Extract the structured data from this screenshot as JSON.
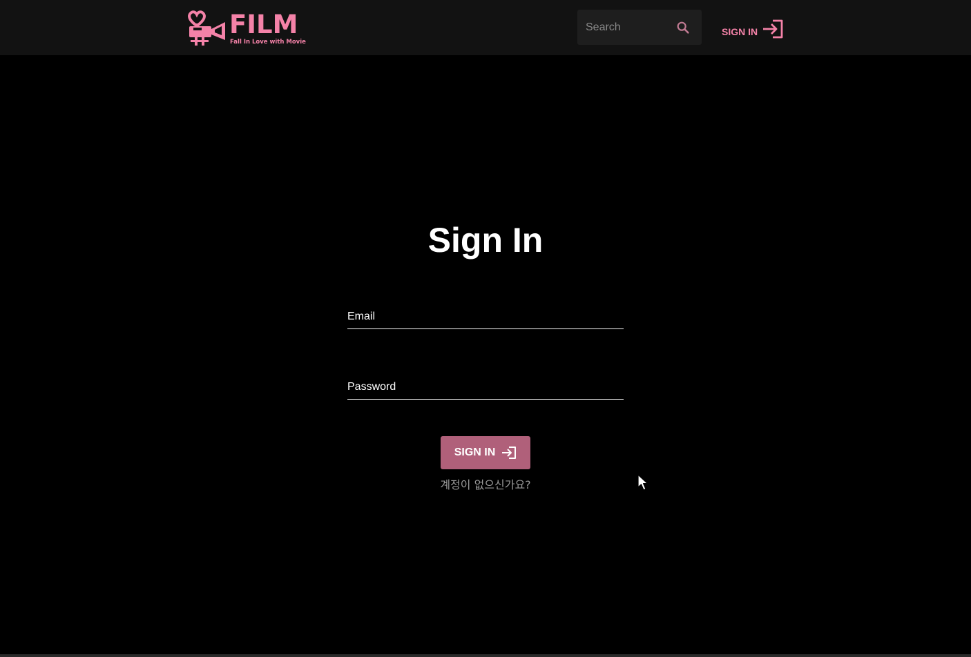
{
  "header": {
    "logo": {
      "word": "FILM",
      "tagline": "Fall In Love with Movie"
    },
    "search": {
      "placeholder": "Search",
      "value": ""
    },
    "signin_label": "SIGN IN"
  },
  "form": {
    "title": "Sign In",
    "email_label": "Email",
    "password_label": "Password",
    "submit_label": "SIGN IN",
    "signup_link": "계정이 없으신가요?"
  },
  "colors": {
    "accent": "#f482a8",
    "button": "#b0607a",
    "header_bg": "#121212",
    "page_bg": "#000000"
  },
  "icons": {
    "logo": "camera-heart-logo-icon",
    "search": "search-icon",
    "signin": "login-arrow-icon"
  }
}
